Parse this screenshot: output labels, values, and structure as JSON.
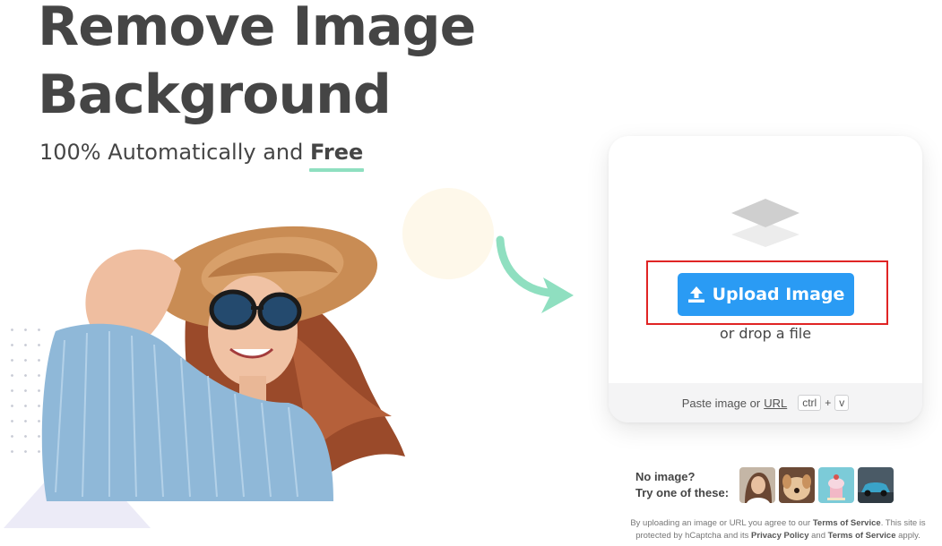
{
  "hero": {
    "title_line1": "Remove Image",
    "title_line2": "Background",
    "subtitle_prefix": "100% Automatically and",
    "subtitle_emphasis": "Free"
  },
  "uploader": {
    "button_label": "Upload Image",
    "drop_text": "or drop a file",
    "paste_prefix": "Paste image or",
    "url_link": "URL",
    "key_ctrl": "ctrl",
    "key_plus": "+",
    "key_v": "v"
  },
  "samples": {
    "line1": "No image?",
    "line2": "Try one of these:",
    "items": [
      "woman-portrait",
      "dog",
      "cake",
      "car"
    ]
  },
  "legal": {
    "part1": "By uploading an image or URL you agree to our",
    "terms1": "Terms of Service",
    "part2": ". This site is protected by hCaptcha and its",
    "privacy": "Privacy Policy",
    "part3": "and",
    "terms2": "Terms of Service",
    "part4": "apply."
  },
  "colors": {
    "accent": "#2a9bf4",
    "title_text": "#454545",
    "underline": "#8fdfc0",
    "arrow": "#8fdfc0",
    "highlight": "#e02424"
  }
}
